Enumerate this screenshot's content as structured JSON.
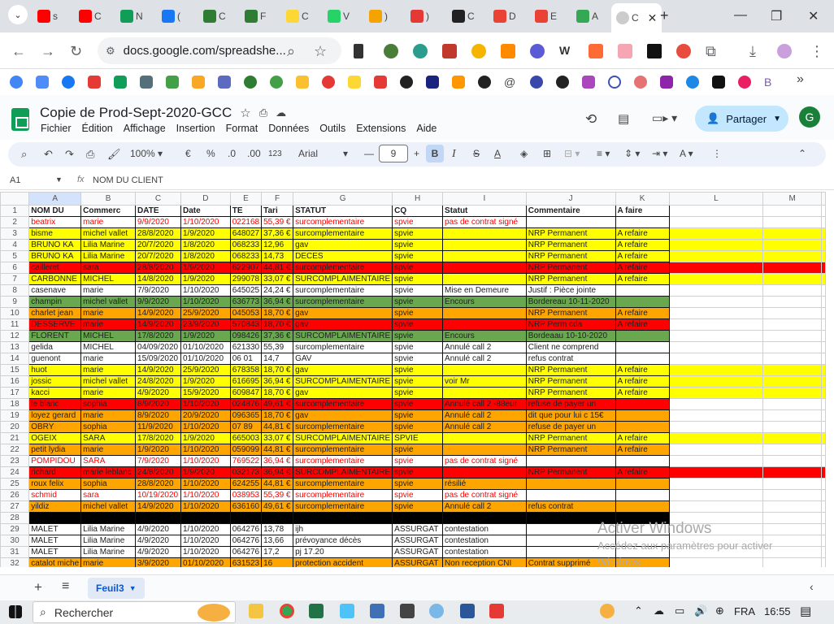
{
  "browser": {
    "tab_labels": [
      "s",
      "C",
      "N",
      "(",
      "C",
      "F",
      "C",
      "V",
      ")",
      ")",
      "C",
      "D",
      "E",
      "A"
    ],
    "active_tab_label": "C",
    "url": "docs.google.com/spreadshe...",
    "new_tab": "+",
    "more_bookmarks": "»"
  },
  "doc": {
    "title": "Copie de Prod-Sept-2020-GCC",
    "menus": [
      "Fichier",
      "Édition",
      "Affichage",
      "Insertion",
      "Format",
      "Données",
      "Outils",
      "Extensions",
      "Aide"
    ],
    "share_label": "Partager",
    "avatar_letter": "G"
  },
  "toolbar": {
    "zoom": "100%",
    "currency": "€",
    "percent": "%",
    "dec_decrease": ".0",
    "dec_increase": ".00",
    "number_format": "123",
    "font": "Arial",
    "font_size": "9",
    "bold": "B",
    "italic": "I",
    "strike": "S",
    "underline": "A"
  },
  "formula_bar": {
    "cell_ref": "A1",
    "fx": "fx",
    "content": "NOM DU CLIENT"
  },
  "columns": [
    "A",
    "B",
    "C",
    "D",
    "E",
    "F",
    "G",
    "H",
    "I",
    "J",
    "K",
    "L",
    "M"
  ],
  "header_row": [
    "NOM DU",
    "Commerc",
    "DATE",
    "Date",
    "TE",
    "Tari",
    "STATUT",
    "CQ",
    "Statut",
    "Commentaire",
    "A faire"
  ],
  "rows": [
    {
      "n": "2",
      "bg": "cW",
      "fg": "fR",
      "ext": "",
      "cells": [
        "beatrix",
        "marie",
        "9/9/2020",
        "1/10/2020",
        "022168",
        "55,39 €",
        "surcomplementaire",
        "spvie",
        "pas de contrat signé",
        "",
        ""
      ]
    },
    {
      "n": "3",
      "bg": "cY",
      "fg": "",
      "ext": "cY",
      "cells": [
        "bisme",
        "michel vallet",
        "28/8/2020",
        "1/9/2020",
        "648027",
        "37,36 €",
        "surcomplementaire",
        "spvie",
        "",
        "NRP Permanent",
        "A refaire"
      ]
    },
    {
      "n": "4",
      "bg": "cY",
      "fg": "",
      "ext": "cY",
      "cells": [
        "BRUNO  KA",
        "Lilia Marine",
        "20/7/2020",
        "1/8/2020",
        "068233",
        "12,96",
        "gav",
        "spvie",
        "",
        "NRP Permanent",
        "A refaire"
      ]
    },
    {
      "n": "5",
      "bg": "cY",
      "fg": "",
      "ext": "cY",
      "cells": [
        "BRUNO  KA",
        "Lilia Marine",
        "20/7/2020",
        "1/8/2020",
        "068233",
        "14,73",
        "DECES",
        "spvie",
        "",
        "NRP Permanent",
        "A refaire"
      ]
    },
    {
      "n": "6",
      "bg": "cR",
      "fg": "",
      "ext": "cR",
      "cells": [
        "cailleret",
        "sara",
        "28/8/2020",
        "1/9/2020",
        "622907",
        "44,81 €",
        "surcomplementaire",
        "spvie",
        "",
        "NRP Permanent",
        "A refaire"
      ]
    },
    {
      "n": "7",
      "bg": "cY",
      "fg": "",
      "ext": "cY",
      "cells": [
        "CARBONNE",
        "MICHEL",
        "14/8/2020",
        "1/9/2020",
        "299078",
        "33,07 €",
        "SURCOMPLAIMENTAIRE",
        "spvie",
        "",
        "NRP Permanent",
        "A refaire"
      ]
    },
    {
      "n": "8",
      "bg": "cW",
      "fg": "",
      "ext": "",
      "cells": [
        "casenave",
        "marie",
        "7/9/2020",
        "1/10/2020",
        "645025",
        "24,24 €",
        "surcomplementaire",
        "spvie",
        "Mise en Demeure",
        "Justif : Pièce jointe",
        ""
      ]
    },
    {
      "n": "9",
      "bg": "cG",
      "fg": "",
      "ext": "",
      "cells": [
        "champin",
        "michel vallet",
        "9/9/2020",
        "1/10/2020",
        "636773",
        "36,94 €",
        "surcomplementaire",
        "spvie",
        "Encours",
        "Bordereau 10-11-2020",
        ""
      ]
    },
    {
      "n": "10",
      "bg": "cO",
      "fg": "",
      "ext": "",
      "cells": [
        "charlet jean",
        "marie",
        "14/9/2020",
        "25/9/2020",
        "045053",
        "18,70 €",
        "gav",
        "spvie",
        "",
        "NRP Permanent",
        "A refaire"
      ]
    },
    {
      "n": "11",
      "bg": "cR",
      "fg": "",
      "ext": "",
      "cells": [
        "DESSERVE",
        "marie",
        "14/9/2020",
        "23/9/2020",
        "570843",
        "18,70 €",
        "gav",
        "spvie",
        "",
        "NRP Perm cda",
        "A refaire"
      ]
    },
    {
      "n": "12",
      "bg": "cG",
      "fg": "",
      "ext": "",
      "cells": [
        "FLORENT",
        "MICHEL",
        "17/8/2020",
        "1/9/2020",
        "098426",
        "37,36 €",
        "SURCOMPLAIMENTAIRE",
        "spvie",
        "Encours",
        "Bordeaau 10-10-2020",
        ""
      ]
    },
    {
      "n": "13",
      "bg": "cW",
      "fg": "",
      "ext": "",
      "cells": [
        "gelida",
        "MICHEL",
        "04/09/2020",
        "01/10/2020",
        "621330",
        "55,39",
        "surcomplementaire",
        "spvie",
        "Annulé call 2",
        "Client ne comprend",
        ""
      ]
    },
    {
      "n": "14",
      "bg": "cW",
      "fg": "",
      "ext": "",
      "cells": [
        "guenont",
        "marie",
        "15/09/2020",
        "01/10/2020",
        "06 01",
        "14,7",
        "GAV",
        "spvie",
        "Annulé call 2",
        "refus contrat",
        ""
      ]
    },
    {
      "n": "15",
      "bg": "cY",
      "fg": "",
      "ext": "cY",
      "cells": [
        "huot",
        "marie",
        "14/9/2020",
        "25/9/2020",
        "678358",
        "18,70 €",
        "gav",
        "spvie",
        "",
        "NRP Permanent",
        "A refaire"
      ]
    },
    {
      "n": "16",
      "bg": "cY",
      "fg": "",
      "ext": "cY",
      "cells": [
        "jossic",
        "michel vallet",
        "24/8/2020",
        "1/9/2020",
        "616695",
        "36,94 €",
        "SURCOMPLAIMENTAIRE",
        "spvie",
        "voir Mr",
        "NRP Permanent",
        "A refaire"
      ]
    },
    {
      "n": "17",
      "bg": "cY",
      "fg": "",
      "ext": "cY",
      "cells": [
        "kacci",
        "marie",
        "4/9/2020",
        "15/9/2020",
        "609847",
        "18,70 €",
        "gav",
        "spvie",
        "",
        "NRP Permanent",
        "A refaire"
      ]
    },
    {
      "n": "18",
      "bg": "cR",
      "fg": "",
      "ext": "",
      "cells": [
        "le blanc",
        "sophia",
        "8/9/2020",
        "1/10/2020",
        "024876",
        "49,61 €",
        "surcomplementaire",
        "spvie",
        "Annulé call 2 -88eur",
        "refuse de payer un",
        ""
      ]
    },
    {
      "n": "19",
      "bg": "cO",
      "fg": "",
      "ext": "",
      "cells": [
        "loyez gerard",
        "marie",
        "8/9/2020",
        "20/9/2020",
        "096365",
        "18,70 €",
        "gav",
        "spvie",
        "Annulé call 2",
        "dit que pour lui c 15€",
        ""
      ]
    },
    {
      "n": "20",
      "bg": "cO",
      "fg": "",
      "ext": "",
      "cells": [
        "OBRY",
        "sophia",
        "11/9/2020",
        "1/10/2020",
        "07 89",
        "44,81 €",
        "surcomplementaire",
        "spvie",
        "Annulé call 2",
        "refuse de payer un",
        ""
      ]
    },
    {
      "n": "21",
      "bg": "cY",
      "fg": "",
      "ext": "cY",
      "cells": [
        "OGEIX",
        "SARA",
        "17/8/2020",
        "1/9/2020",
        "665003",
        "33,07 €",
        "SURCOMPLAIMENTAIRE",
        "SPVIE",
        "",
        "NRP Permanent",
        "A refaire"
      ]
    },
    {
      "n": "22",
      "bg": "cO",
      "fg": "",
      "ext": "",
      "cells": [
        "petit lydia",
        "marie",
        "1/9/2020",
        "1/10/2020",
        "059099",
        "44,81 €",
        "surcomplementaire",
        "spvie",
        "",
        "NRP Permanent",
        "A refaire"
      ]
    },
    {
      "n": "23",
      "bg": "cW",
      "fg": "fR",
      "ext": "",
      "cells": [
        "POMPIDOU",
        "SARA",
        "7/9/2020",
        "1/10/2020",
        "769522",
        "36,94 €",
        "surcomplementaire",
        "spvie",
        "pas de contrat signé",
        "",
        ""
      ]
    },
    {
      "n": "24",
      "bg": "cR",
      "fg": "",
      "ext": "cR",
      "cells": [
        "richard",
        "marie leblanc",
        "24/8/2020",
        "1/9/2020",
        "032173",
        "36,94 €",
        "SURCOMPLAIMENTAIRE",
        "spvie",
        "",
        "NRP Permanent",
        "A refaire"
      ]
    },
    {
      "n": "25",
      "bg": "cO",
      "fg": "",
      "ext": "",
      "cells": [
        "roux felix",
        "sophia",
        "28/8/2020",
        "1/10/2020",
        "624255",
        "44,81 €",
        "surcomplementaire",
        "spvie",
        "résilié",
        "",
        ""
      ]
    },
    {
      "n": "26",
      "bg": "cW",
      "fg": "fR",
      "ext": "",
      "cells": [
        "schmid",
        "sara",
        "10/19/2020",
        "1/10/2020",
        "038953",
        "55,39 €",
        "surcomplementaire",
        "spvie",
        "pas de contrat signé",
        "",
        ""
      ]
    },
    {
      "n": "27",
      "bg": "cO",
      "fg": "",
      "ext": "",
      "cells": [
        "yildiz",
        "michel vallet",
        "14/9/2020",
        "1/10/2020",
        "636160",
        "49,61 €",
        "surcomplementaire",
        "spvie",
        "Annulé call 2",
        "refus contrat",
        ""
      ]
    },
    {
      "n": "28",
      "bg": "cK",
      "fg": "",
      "ext": "",
      "cells": [
        "",
        "",
        "",
        "",
        "",
        "",
        "",
        "",
        "",
        "",
        ""
      ]
    },
    {
      "n": "29",
      "bg": "cW",
      "fg": "",
      "ext": "",
      "cells": [
        " MALET",
        "Lilia Marine",
        "4/9/2020",
        "1/10/2020",
        "064276",
        "13,78",
        "ijh",
        "ASSURGAT",
        "contestation",
        "",
        ""
      ]
    },
    {
      "n": "30",
      "bg": "cW",
      "fg": "",
      "ext": "",
      "cells": [
        " MALET",
        "Lilia Marine",
        "4/9/2020",
        "1/10/2020",
        "064276",
        "13,66",
        "prévoyance décès",
        "ASSURGAT",
        "contestation",
        "",
        ""
      ]
    },
    {
      "n": "31",
      "bg": "cW",
      "fg": "",
      "ext": "",
      "cells": [
        " MALET",
        "Lilia Marine",
        "4/9/2020",
        "1/10/2020",
        "064276",
        "17,2",
        "pj 17.20",
        "ASSURGAT",
        "contestation",
        "",
        ""
      ]
    },
    {
      "n": "32",
      "bg": "cO",
      "fg": "",
      "ext": "",
      "cells": [
        "catalot miche",
        "marie",
        "3/9/2020",
        "01/10/2020",
        "631523",
        "16",
        "protection accident",
        "ASSURGAT",
        "Non reception CNI",
        "Contrat supprimé",
        ""
      ]
    }
  ],
  "watermark": {
    "title": "Activer Windows",
    "line": "Accédez aux paramètres pour activer Windows."
  },
  "sheet": {
    "add": "+",
    "list": "≡",
    "tab_name": "Feuil3"
  },
  "taskbar": {
    "search": "Rechercher",
    "lang": "FRA",
    "time": "16:55"
  }
}
